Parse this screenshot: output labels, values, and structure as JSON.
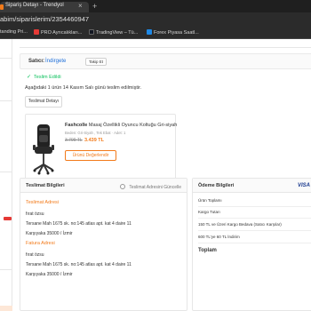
{
  "browser": {
    "tab_title": "Sipariş Detayı - Trendyol",
    "tab_close": "×",
    "new_tab": "+",
    "url": "abim/siparislerim/2354460947",
    "bookmarks": [
      {
        "label": "tanding Pri...",
        "icon_color": "#2b2b2b"
      },
      {
        "label": "PRO Ayrıcalıkları...",
        "icon_color": "#e53935"
      },
      {
        "label": "TradingView – Tü...",
        "icon_color": "#131722"
      },
      {
        "label": "Forex Piyasa Saatl...",
        "icon_color": "#1e88e5"
      }
    ]
  },
  "seller": {
    "label": "Satıcı:",
    "name": "İndirgete",
    "follow": "Takip Et"
  },
  "status": {
    "check": "✓",
    "title": "Teslim Edildi",
    "description": "Aşağıdaki 1 ürün 14 Kasım Salı günü teslim edilmiştir.",
    "detail_button": "Teslimat Detayı"
  },
  "product": {
    "brand": "Fashcolle",
    "name": "Masaj Özellikli Oyuncu Koltuğu Gri-siyah",
    "meta": "Beden: Gri-Siyah , Tek Ebat · Adet: 1",
    "old_price": "3.799 TL",
    "new_price": "3.439 TL",
    "review_button": "Ürünü Değerlendir"
  },
  "address": {
    "title": "Teslimat Bilgileri",
    "update_link": "Teslimat Adresini Güncelle",
    "delivery_title": "Teslimat Adresi",
    "delivery_name": "fırat özsu",
    "delivery_street": "Tersane Mah 1675 sk. no:145 atlas apt. kat 4 daire 11",
    "delivery_city": "Karşıyaka 35000 / İzmir",
    "invoice_title": "Fatura Adresi",
    "invoice_name": "fırat özsu",
    "invoice_street": "Tersane Mah 1675 sk. no:145 atlas apt. kat 4 daire 11",
    "invoice_city": "Karşıyaka 35000 / İzmir"
  },
  "payment": {
    "title": "Ödeme Bilgileri",
    "card_brand": "VISA",
    "lines": [
      "Ürün Toplamı",
      "Kargo Tutarı",
      "150 TL ve Üzeri Kargo Bedava (Satıcı Karşılar)",
      "600 TL'ye 60 TL İndirim"
    ],
    "total_label": "Toplam"
  },
  "colors": {
    "accent": "#f27a1a",
    "success": "#0bc15c",
    "link": "#1e6fd9"
  }
}
